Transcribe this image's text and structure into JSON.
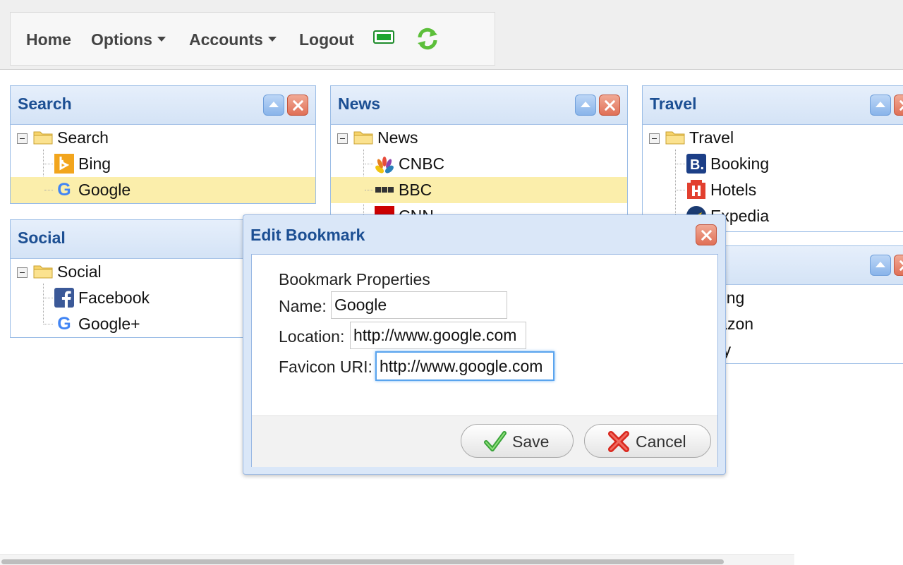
{
  "menu": {
    "home": "Home",
    "options": "Options",
    "accounts": "Accounts",
    "logout": "Logout",
    "battery_icon": "battery-icon",
    "refresh_icon": "refresh-icon"
  },
  "panels": {
    "search": {
      "title": "Search",
      "folder": "Search",
      "items": [
        {
          "label": "Bing",
          "icon": "bing-icon"
        },
        {
          "label": "Google",
          "icon": "google-icon",
          "selected": true
        }
      ]
    },
    "news": {
      "title": "News",
      "folder": "News",
      "items": [
        {
          "label": "CNBC",
          "icon": "cnbc-icon"
        },
        {
          "label": "BBC",
          "icon": "bbc-icon",
          "selected": true
        },
        {
          "label": "CNN",
          "icon": "cnn-icon"
        }
      ]
    },
    "travel": {
      "title": "Travel",
      "folder": "Travel",
      "items": [
        {
          "label": "Booking",
          "icon": "booking-icon"
        },
        {
          "label": "Hotels",
          "icon": "hotels-icon"
        },
        {
          "label": "Expedia",
          "icon": "expedia-icon"
        }
      ]
    },
    "social": {
      "title": "Social",
      "folder": "Social",
      "items": [
        {
          "label": "Facebook",
          "icon": "facebook-icon"
        },
        {
          "label": "Google+",
          "icon": "google-icon"
        }
      ]
    },
    "shopping": {
      "items": [
        {
          "label": "pping"
        },
        {
          "label": "mazon"
        },
        {
          "label": "bay"
        }
      ]
    }
  },
  "dialog": {
    "title": "Edit Bookmark",
    "heading": "Bookmark Properties",
    "name_label": "Name:",
    "name_value": "Google",
    "location_label": "Location:",
    "location_value": "http://www.google.com",
    "favicon_label": "Favicon URI:",
    "favicon_value": "http://www.google.com",
    "save_label": "Save",
    "cancel_label": "Cancel"
  },
  "colors": {
    "panel_title": "#1c4f93",
    "selected_row": "#fbeeab",
    "panel_border": "#9bbde6"
  }
}
